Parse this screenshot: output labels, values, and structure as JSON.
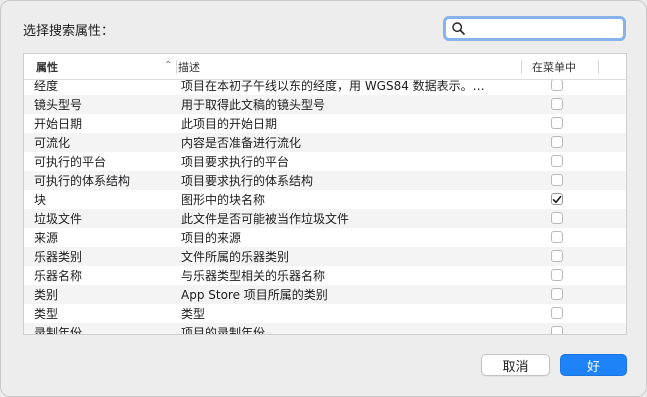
{
  "dialog": {
    "prompt": "选择搜索属性：",
    "search": {
      "value": "",
      "placeholder": ""
    }
  },
  "table": {
    "columns": {
      "attribute": "属性",
      "description": "描述",
      "in_menu": "在菜单中"
    },
    "rows": [
      {
        "attribute": "经度",
        "description": "项目在本初子午线以东的经度，用 WGS84 数据表示。…",
        "in_menu": false
      },
      {
        "attribute": "镜头型号",
        "description": "用于取得此文稿的镜头型号",
        "in_menu": false
      },
      {
        "attribute": "开始日期",
        "description": "此项目的开始日期",
        "in_menu": false
      },
      {
        "attribute": "可流化",
        "description": "内容是否准备进行流化",
        "in_menu": false
      },
      {
        "attribute": "可执行的平台",
        "description": "项目要求执行的平台",
        "in_menu": false
      },
      {
        "attribute": "可执行的体系结构",
        "description": "项目要求执行的体系结构",
        "in_menu": false
      },
      {
        "attribute": "块",
        "description": "图形中的块名称",
        "in_menu": true
      },
      {
        "attribute": "垃圾文件",
        "description": "此文件是否可能被当作垃圾文件",
        "in_menu": false
      },
      {
        "attribute": "来源",
        "description": "项目的来源",
        "in_menu": false
      },
      {
        "attribute": "乐器类别",
        "description": "文件所属的乐器类别",
        "in_menu": false
      },
      {
        "attribute": "乐器名称",
        "description": "与乐器类型相关的乐器名称",
        "in_menu": false
      },
      {
        "attribute": "类别",
        "description": "App Store 项目所属的类别",
        "in_menu": false
      },
      {
        "attribute": "类型",
        "description": "类型",
        "in_menu": false
      },
      {
        "attribute": "录制年份",
        "description": "项目的录制年份",
        "in_menu": false
      }
    ]
  },
  "buttons": {
    "cancel": "取消",
    "ok": "好"
  },
  "colors": {
    "accent": "#1e83f7",
    "focus_ring": "#86b3ec"
  },
  "icons": {
    "search": "search-icon",
    "sort": "sort-ascending-icon",
    "checkmark": "checkmark-icon"
  }
}
